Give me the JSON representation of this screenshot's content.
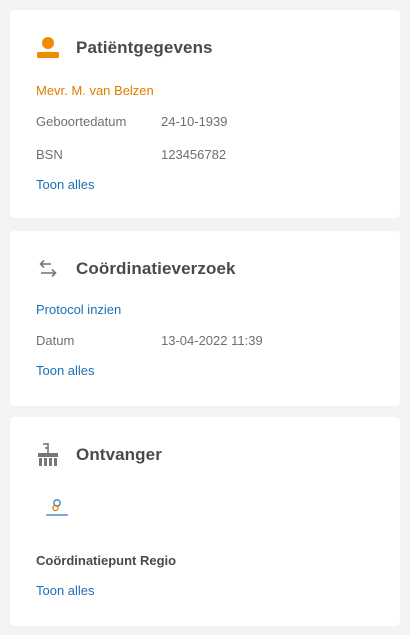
{
  "patient_card": {
    "title": "Patiëntgegevens",
    "icon": "person-icon",
    "name": "Mevr. M. van Belzen",
    "fields": [
      {
        "label": "Geboortedatum",
        "value": "24-10-1939"
      },
      {
        "label": "BSN",
        "value": "123456782"
      }
    ],
    "show_all": "Toon alles"
  },
  "coordination_card": {
    "title": "Coördinatieverzoek",
    "icon": "swap-arrows-icon",
    "protocol_link": "Protocol inzien",
    "fields": [
      {
        "label": "Datum",
        "value": "13-04-2022 11:39"
      }
    ],
    "show_all": "Toon alles"
  },
  "receiver_card": {
    "title": "Ontvanger",
    "icon": "organization-icon",
    "logo_icon": "organization-logo-icon",
    "org_name": "Coördinatiepunt Regio",
    "show_all": "Toon alles"
  },
  "colors": {
    "accent_orange": "#e07b00",
    "link_blue": "#1c6fb8",
    "background": "#f3f3f3",
    "card": "#ffffff"
  }
}
